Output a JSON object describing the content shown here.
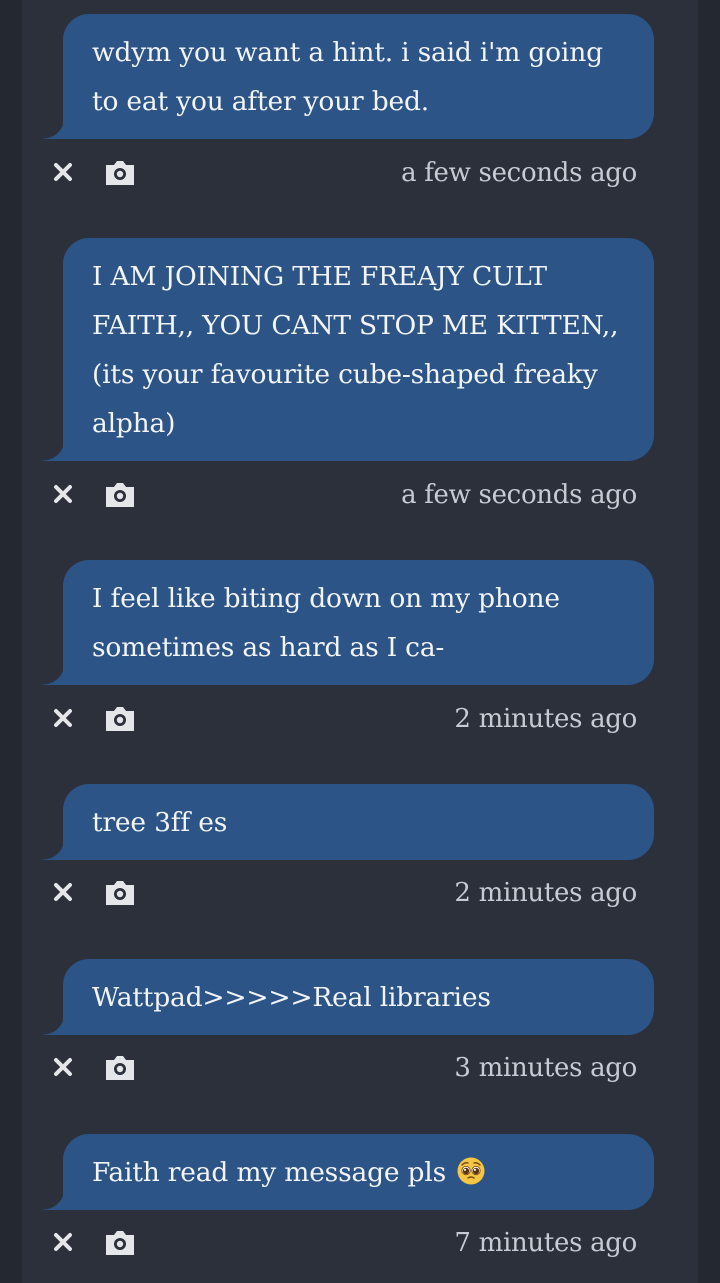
{
  "messages": [
    {
      "text": "wdym you want a hint. i said i'm going to eat you after your bed.",
      "time": "a few seconds ago"
    },
    {
      "text": "I AM JOINING THE FREAJY CULT FAITH,, YOU CANT STOP ME KITTEN,, (its your favourite cube-shaped freaky alpha)",
      "time": "a few seconds ago"
    },
    {
      "text": "I feel like biting down on my phone sometimes as hard as I ca-",
      "time": "2 minutes ago"
    },
    {
      "text": "tree 3ff es",
      "time": "2 minutes ago"
    },
    {
      "text": "Wattpad>>>>>Real libraries",
      "time": "3 minutes ago"
    },
    {
      "text": "Faith read my message pls",
      "time": "7 minutes ago"
    }
  ],
  "icons": {
    "delete": "close-icon",
    "screenshot": "camera-icon",
    "emoji": "pleading-face-emoji"
  },
  "colors": {
    "background": "#242831",
    "panel": "#2b303b",
    "bubble": "#2c5486",
    "text": "#f2f4f7",
    "timestamp": "#c7cbd3",
    "icon": "#e4e6ea"
  }
}
